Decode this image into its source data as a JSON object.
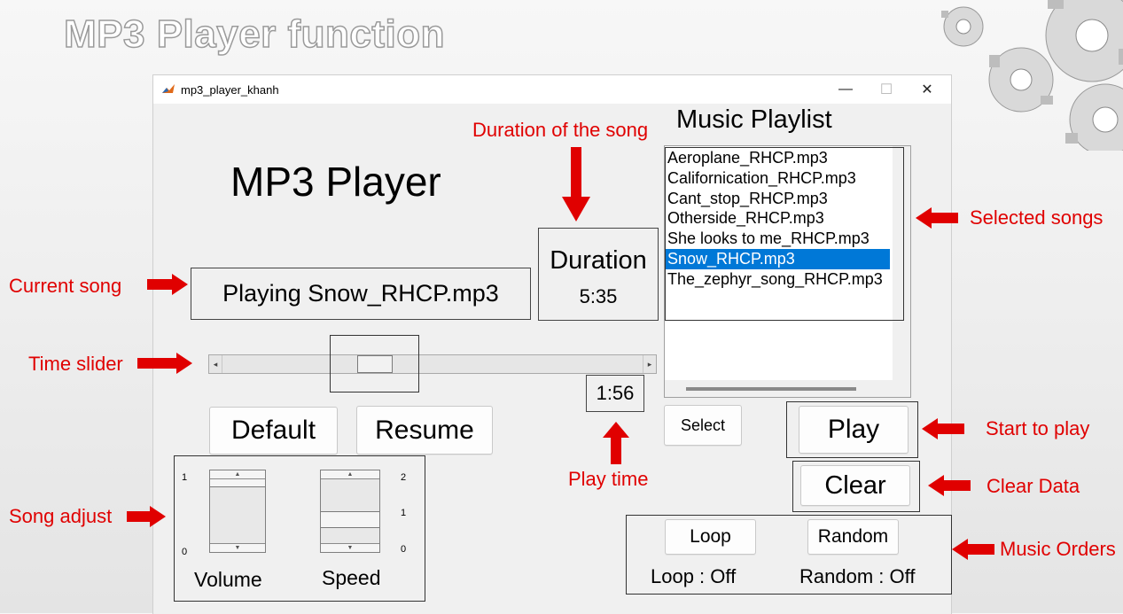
{
  "slide": {
    "title": "MP3 Player function"
  },
  "window": {
    "title": "mp3_player_khanh",
    "minimize_glyph": "—",
    "maximize_glyph": "☐",
    "close_glyph": "✕"
  },
  "app": {
    "heading": "MP3 Player",
    "current_song": "Playing Snow_RHCP.mp3",
    "duration_label": "Duration",
    "duration_value": "5:35",
    "play_time": "1:56",
    "time_slider": {
      "position_fraction": 0.35
    },
    "buttons": {
      "default": "Default",
      "resume": "Resume",
      "select": "Select",
      "play": "Play",
      "clear": "Clear",
      "loop": "Loop",
      "random": "Random"
    },
    "status": {
      "loop": "Loop : Off",
      "random": "Random : Off"
    },
    "playlist_title": "Music Playlist",
    "playlist": [
      "Aeroplane_RHCP.mp3",
      "Californication_RHCP.mp3",
      "Cant_stop_RHCP.mp3",
      "Otherside_RHCP.mp3",
      "She looks to me_RHCP.mp3",
      "Snow_RHCP.mp3",
      "The_zephyr_song_RHCP.mp3"
    ],
    "playlist_selected_index": 5,
    "volume": {
      "label": "Volume",
      "max_label": "1",
      "min_label": "0"
    },
    "speed": {
      "label": "Speed",
      "max_label": "2",
      "mid_label": "1",
      "min_label": "0"
    }
  },
  "annotations": {
    "duration_of_song": "Duration of the song",
    "selected_songs": "Selected songs",
    "current_song": "Current song",
    "time_slider": "Time slider",
    "play_time": "Play time",
    "start_to_play": "Start to play",
    "clear_data": "Clear Data",
    "song_adjust": "Song adjust",
    "music_orders": "Music Orders"
  },
  "colors": {
    "annotation": "#e00000",
    "selection": "#0078d7"
  }
}
